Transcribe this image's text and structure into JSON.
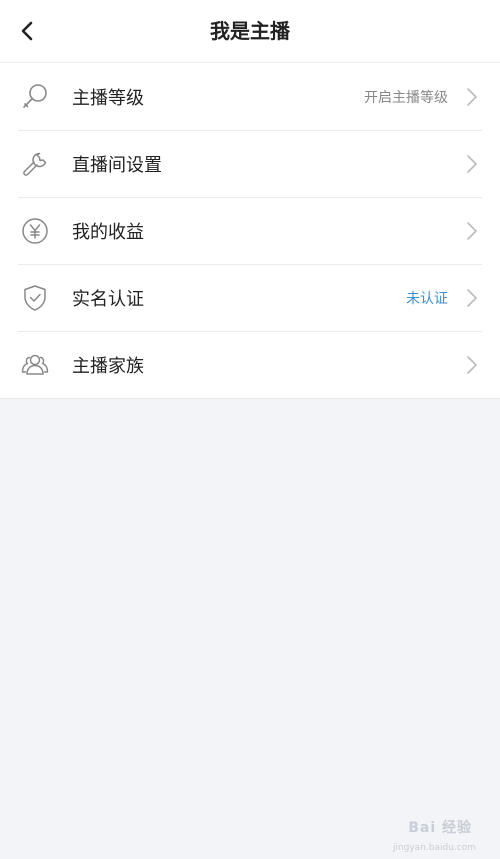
{
  "header": {
    "title": "我是主播"
  },
  "menu": [
    {
      "label": "主播等级",
      "value": "开启主播等级",
      "icon": "microphone-icon"
    },
    {
      "label": "直播间设置",
      "value": "",
      "icon": "wrench-icon"
    },
    {
      "label": "我的收益",
      "value": "",
      "icon": "yuan-icon"
    },
    {
      "label": "实名认证",
      "value": "未认证",
      "icon": "shield-check-icon"
    },
    {
      "label": "主播家族",
      "value": "",
      "icon": "group-icon"
    }
  ],
  "colors": {
    "background": "#f2f4f7",
    "text": "#222222",
    "muted": "#888888",
    "accent_blue": "#3d8fd8"
  },
  "watermark": {
    "brand": "Bai 经验",
    "url": "jingyan.baidu.com"
  }
}
